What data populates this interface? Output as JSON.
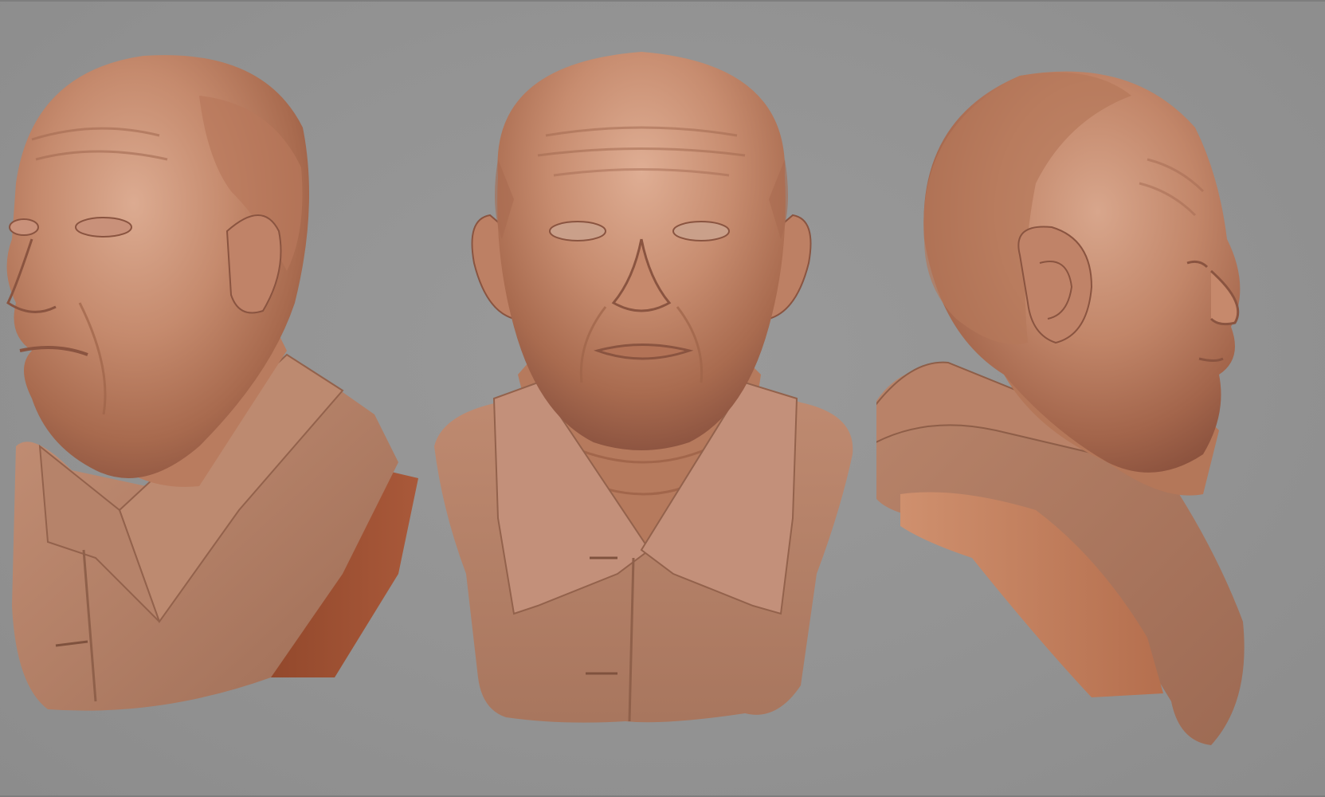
{
  "scene": {
    "background_color": "#929292",
    "clay_color": "#b77b5e",
    "shadow_color": "#8a4f36",
    "highlight_color": "#d9a78d",
    "cut_color": "#a65233"
  },
  "busts": [
    {
      "view": "three-quarter-left"
    },
    {
      "view": "front"
    },
    {
      "view": "right-profile-back"
    }
  ]
}
